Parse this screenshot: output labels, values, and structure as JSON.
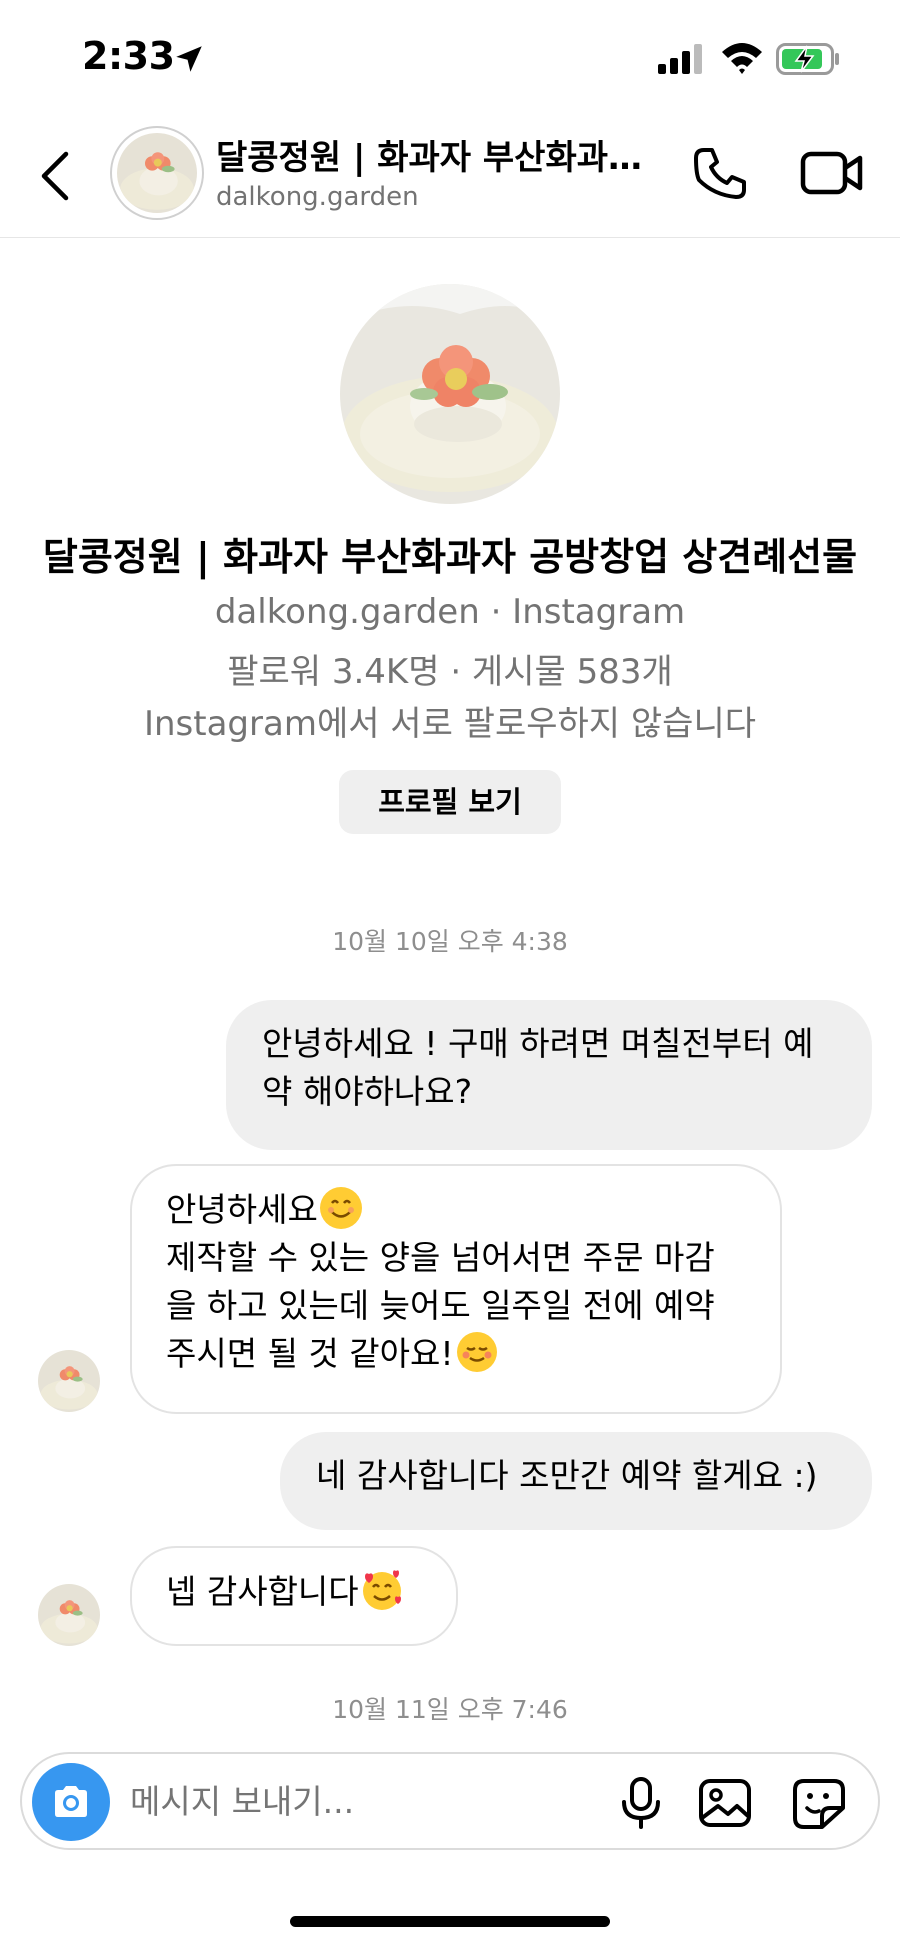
{
  "status_bar": {
    "time": "2:33",
    "icons": [
      "location-arrow-icon",
      "signal-icon",
      "wifi-icon",
      "battery-charging-icon"
    ]
  },
  "header": {
    "title": "달콩정원 | 화과자 부산화과자 공방창업 상견례선물",
    "username": "dalkong.garden",
    "icons": [
      "back-icon",
      "phone-icon",
      "video-camera-icon"
    ]
  },
  "profile": {
    "name": "달콩정원 | 화과자 부산화과자 공방창업 상견례선물",
    "handle_line": "dalkong.garden · Instagram",
    "stats_line": "팔로워 3.4K명 · 게시물 583개",
    "mutual_line": "Instagram에서 서로 팔로우하지 않습니다",
    "view_profile_label": "프로필 보기"
  },
  "chat": {
    "timestamp_1": "10월 10일 오후 4:38",
    "messages": [
      {
        "direction": "outgoing",
        "lines": [
          "안녕하세요 ! 구매 하려면 며칠전부터 예",
          "약 해야하나요?"
        ]
      },
      {
        "direction": "incoming",
        "lines": [
          "안녕하세요",
          "제작할 수 있는 양을 넘어서면 주문 마감",
          "을 하고 있는데 늦어도 일주일 전에 예약",
          "주시면 될 것 같아요!"
        ],
        "emojis": [
          "smiling-face-emoji",
          "relieved-face-emoji"
        ]
      },
      {
        "direction": "outgoing",
        "lines": [
          "네 감사합니다 조만간 예약 할게요 :)"
        ]
      },
      {
        "direction": "incoming",
        "lines": [
          "넵 감사합니다"
        ],
        "emojis": [
          "smiling-face-with-hearts-emoji"
        ]
      }
    ],
    "timestamp_2": "10월 11일 오후 7:46"
  },
  "composer": {
    "placeholder": "메시지 보내기...",
    "icons": [
      "camera-icon",
      "microphone-icon",
      "image-icon",
      "sticker-icon"
    ]
  },
  "colors": {
    "accent_blue": "#3797f0",
    "outgoing_bubble": "#efefef",
    "secondary_text": "#737373",
    "battery_green": "#34c759"
  }
}
